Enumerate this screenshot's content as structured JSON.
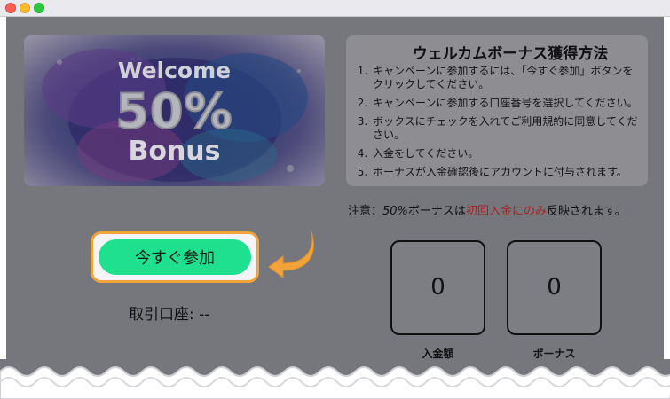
{
  "banner": {
    "line1": "Welcome",
    "line2": "50%",
    "line3": "Bonus"
  },
  "instructions": {
    "title": "ウェルカムボーナス獲得方法",
    "steps": [
      "キャンペーンに参加するには、「今すぐ参加」ボタンをクリックしてください。",
      "キャンペーンに参加する口座番号を選択してください。",
      "ボックスにチェックを入れてご利用規約に同意してください。",
      "入金をしてください。",
      "ボーナスが入金確認後にアカウントに付与されます。"
    ]
  },
  "note": {
    "prefix": "注意：",
    "pct": "50%",
    "middle": "ボーナスは",
    "highlight": "初回入金にのみ",
    "suffix": "反映されます。"
  },
  "join_button": {
    "label": "今すぐ参加"
  },
  "account": {
    "label": "取引口座: --"
  },
  "deposit": {
    "value": "0",
    "label": "入金額"
  },
  "bonus_box": {
    "value": "0",
    "label": "ボーナス"
  },
  "colors": {
    "accent": "#1ee08e",
    "highlight_border": "#f2a33a",
    "note_highlight": "#a42424",
    "overlay": "#76777d"
  },
  "icons": {
    "arrow": "curved-arrow-icon"
  }
}
